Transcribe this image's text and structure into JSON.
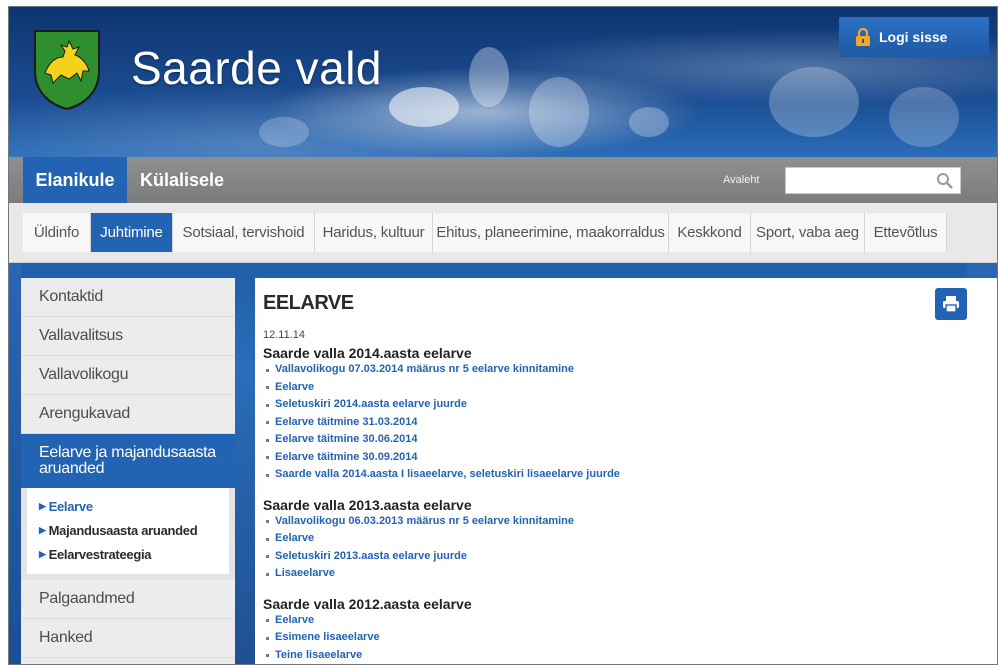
{
  "header": {
    "site_title": "Saarde vald",
    "login_label": "Logi sisse",
    "logo_icon": "coat-of-arms-icon"
  },
  "tabs": [
    {
      "label": "Elanikule",
      "active": true
    },
    {
      "label": "Külalisele",
      "active": false
    }
  ],
  "tabbar": {
    "home_link": "Avaleht",
    "search_placeholder": "",
    "search_icon": "search-icon"
  },
  "menu": [
    {
      "label": "Üldinfo"
    },
    {
      "label": "Juhtimine",
      "active": true
    },
    {
      "label": "Sotsiaal, tervishoid"
    },
    {
      "label": "Haridus, kultuur"
    },
    {
      "label": "Ehitus, planeerimine, maakorraldus"
    },
    {
      "label": "Keskkond"
    },
    {
      "label": "Sport, vaba aeg"
    },
    {
      "label": "Ettevõtlus"
    }
  ],
  "sidebar": {
    "items": [
      {
        "label": "Kontaktid"
      },
      {
        "label": "Vallavalitsus"
      },
      {
        "label": "Vallavolikogu"
      },
      {
        "label": "Arengukavad"
      },
      {
        "label": "Eelarve ja majandusaasta aruanded",
        "active": true
      },
      {
        "label": "Palgaandmed"
      },
      {
        "label": "Hanked"
      }
    ],
    "submenu": [
      {
        "label": "Eelarve",
        "current": true
      },
      {
        "label": "Majandusaasta aruanded"
      },
      {
        "label": "Eelarvestrateegia"
      }
    ]
  },
  "content": {
    "title": "EELARVE",
    "date": "12.11.14",
    "print_icon": "print-icon",
    "sections": [
      {
        "heading": "Saarde valla 2014.aasta eelarve",
        "links": [
          "Vallavolikogu 07.03.2014 määrus nr 5 eelarve kinnitamine",
          "Eelarve",
          "Seletuskiri 2014.aasta eelarve juurde",
          "Eelarve täitmine 31.03.2014",
          "Eelarve täitmine 30.06.2014",
          "Eelarve täitmine 30.09.2014",
          "Saarde valla 2014.aasta I lisaeelarve, seletuskiri lisaeelarve juurde"
        ]
      },
      {
        "heading": "Saarde valla 2013.aasta eelarve",
        "links": [
          "Vallavolikogu 06.03.2013 määrus nr 5 eelarve kinnitamine",
          "Eelarve",
          "Seletuskiri 2013.aasta eelarve juurde",
          "Lisaeelarve"
        ]
      },
      {
        "heading": "Saarde valla 2012.aasta eelarve",
        "links": [
          "Eelarve",
          "Esimene lisaeelarve",
          "Teine lisaeelarve"
        ]
      }
    ]
  },
  "colors": {
    "accent": "#2363b4",
    "tabbar": "#7f8183",
    "menubar": "#e8e8e8"
  }
}
